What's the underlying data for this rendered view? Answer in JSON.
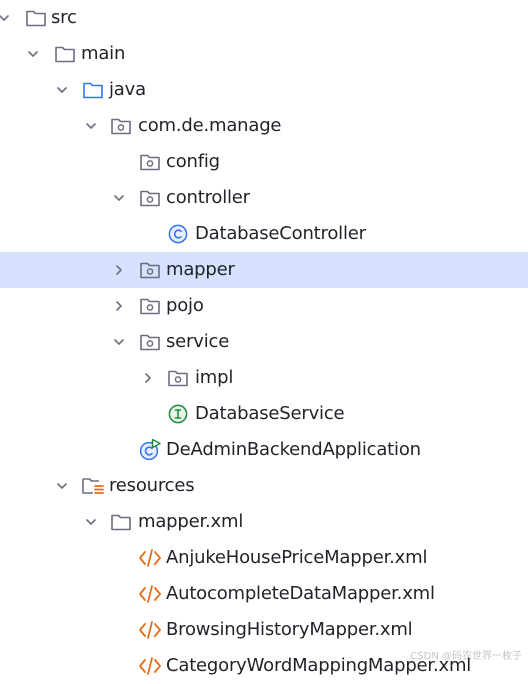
{
  "tree": {
    "nodes": [
      {
        "label": "src",
        "chevron": "down",
        "icon": "folder"
      },
      {
        "label": "main",
        "chevron": "down",
        "icon": "folder"
      },
      {
        "label": "java",
        "chevron": "down",
        "icon": "source-folder"
      },
      {
        "label": "com.de.manage",
        "chevron": "down",
        "icon": "package"
      },
      {
        "label": "config",
        "chevron": "",
        "icon": "package"
      },
      {
        "label": "controller",
        "chevron": "down",
        "icon": "package"
      },
      {
        "label": "DatabaseController",
        "chevron": "",
        "icon": "class"
      },
      {
        "label": "mapper",
        "chevron": "right",
        "icon": "package"
      },
      {
        "label": "pojo",
        "chevron": "right",
        "icon": "package"
      },
      {
        "label": "service",
        "chevron": "down",
        "icon": "package"
      },
      {
        "label": "impl",
        "chevron": "right",
        "icon": "package"
      },
      {
        "label": "DatabaseService",
        "chevron": "",
        "icon": "interface"
      },
      {
        "label": "DeAdminBackendApplication",
        "chevron": "",
        "icon": "spring-app"
      },
      {
        "label": "resources",
        "chevron": "down",
        "icon": "resources-folder"
      },
      {
        "label": "mapper.xml",
        "chevron": "down",
        "icon": "folder"
      },
      {
        "label": "AnjukeHousePriceMapper.xml",
        "chevron": "",
        "icon": "xml"
      },
      {
        "label": "AutocompleteDataMapper.xml",
        "chevron": "",
        "icon": "xml"
      },
      {
        "label": "BrowsingHistoryMapper.xml",
        "chevron": "",
        "icon": "xml"
      },
      {
        "label": "CategoryWordMappingMapper.xml",
        "chevron": "",
        "icon": "xml"
      }
    ],
    "selected_label": "mapper"
  },
  "colors": {
    "selection": "#d5e1fd",
    "folder_stroke": "#6c707e",
    "source_folder_stroke": "#3574f0",
    "class_blue": "#3574f0",
    "interface_green": "#208a3c",
    "xml_orange": "#e66d17"
  },
  "watermark": "CSDN @码农世界一枚子"
}
